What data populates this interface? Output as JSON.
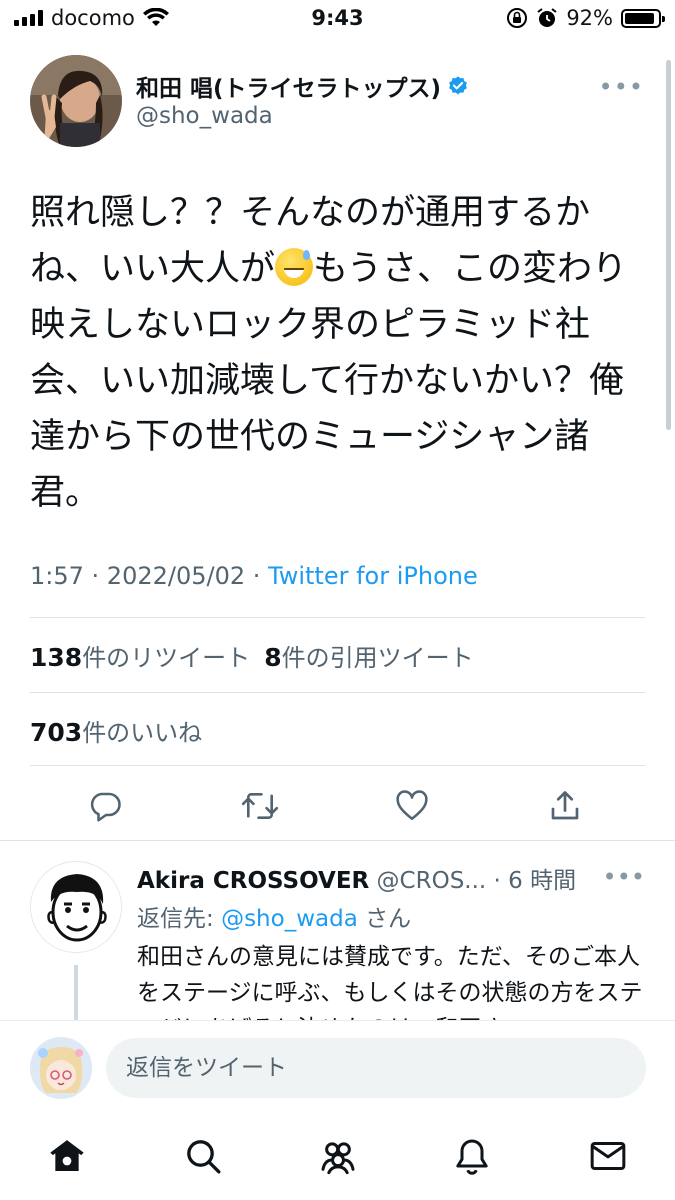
{
  "status_bar": {
    "carrier": "docomo",
    "time": "9:43",
    "battery_percent": "92%",
    "battery_level": 0.92
  },
  "tweet": {
    "display_name": "和田 唱(トライセラトップス)",
    "username": "@sho_wada",
    "verified_icon": "verified-badge-icon",
    "more_icon": "more-horizontal-icon",
    "text_before_emoji": "照れ隠し？？そんなのが通用するかね、いい大人が",
    "emoji_icon": "grinning-sweat-emoji",
    "text_after_emoji": "もうさ、この変わり映えしないロック界のピラミッド社会、いい加減壊して行かないかい？俺達から下の世代のミュージシャン諸君。",
    "time": "1:57",
    "date": "2022/05/02",
    "separator": " · ",
    "source": "Twitter for iPhone",
    "retweets_count": "138",
    "retweets_label": "件のリツイート",
    "quotes_count": "8",
    "quotes_label": "件の引用ツイート",
    "likes_count": "703",
    "likes_label": "件のいいね"
  },
  "actions": {
    "reply_icon": "reply-icon",
    "retweet_icon": "retweet-icon",
    "like_icon": "heart-icon",
    "share_icon": "share-icon"
  },
  "reply": {
    "display_name": "Akira CROSSOVER",
    "handle_time": " @CROS... · 6 時間",
    "reply_to_label": "返信先: ",
    "reply_to_mention": "@sho_wada",
    "reply_to_suffix": " さん",
    "text": "和田さんの意見には賛成です。ただ、そのご本人をステージに呼ぶ、もしくはその状態の方をステージにあげると決めたのは、和田さ"
  },
  "composer": {
    "placeholder": "返信をツイート"
  },
  "tabbar": {
    "home": "home-icon",
    "search": "search-icon",
    "communities": "communities-icon",
    "notifications": "bell-icon",
    "messages": "mail-icon"
  },
  "colors": {
    "accent": "#1d9bf0",
    "muted": "#536471",
    "text": "#0f1419"
  }
}
